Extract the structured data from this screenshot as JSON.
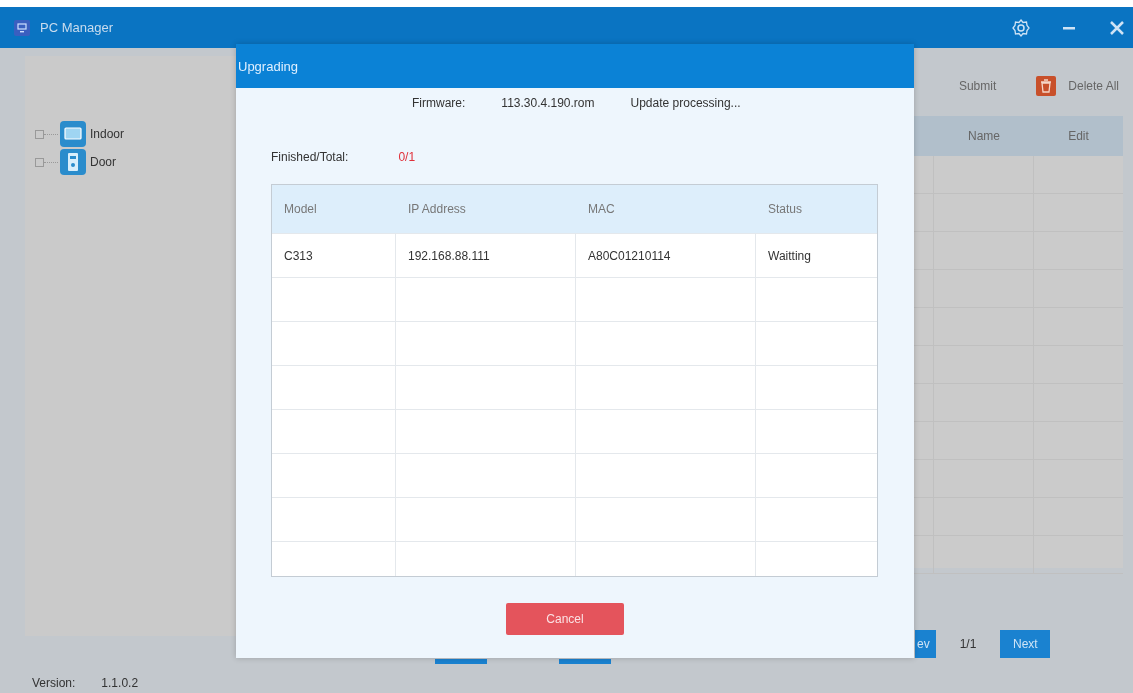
{
  "window": {
    "title": "PC Manager"
  },
  "tree": [
    {
      "label": "Indoor",
      "kind": "indoor",
      "expanded": false
    },
    {
      "label": "Door",
      "kind": "door",
      "expanded": false
    }
  ],
  "toolbar": {
    "submit": "Submit",
    "delete_all": "Delete All"
  },
  "device_table": {
    "columns": [
      "",
      "Name",
      "Edit"
    ]
  },
  "pager": {
    "prev": "ev",
    "page": "1/1",
    "next": "Next"
  },
  "version": {
    "label": "Version:",
    "value": "1.1.0.2"
  },
  "dialog": {
    "title": "Upgrading",
    "firmware_label": "Firmware:",
    "firmware": "113.30.4.190.rom",
    "message": "Update processing...",
    "progress_label": "Finished/Total:",
    "progress": "0/1",
    "table": {
      "columns": [
        "Model",
        "IP Address",
        "MAC",
        "Status"
      ],
      "rows": [
        [
          "C313",
          "192.168.88.111",
          "A80C01210114",
          "Waitting"
        ]
      ]
    },
    "cancel": "Cancel"
  }
}
